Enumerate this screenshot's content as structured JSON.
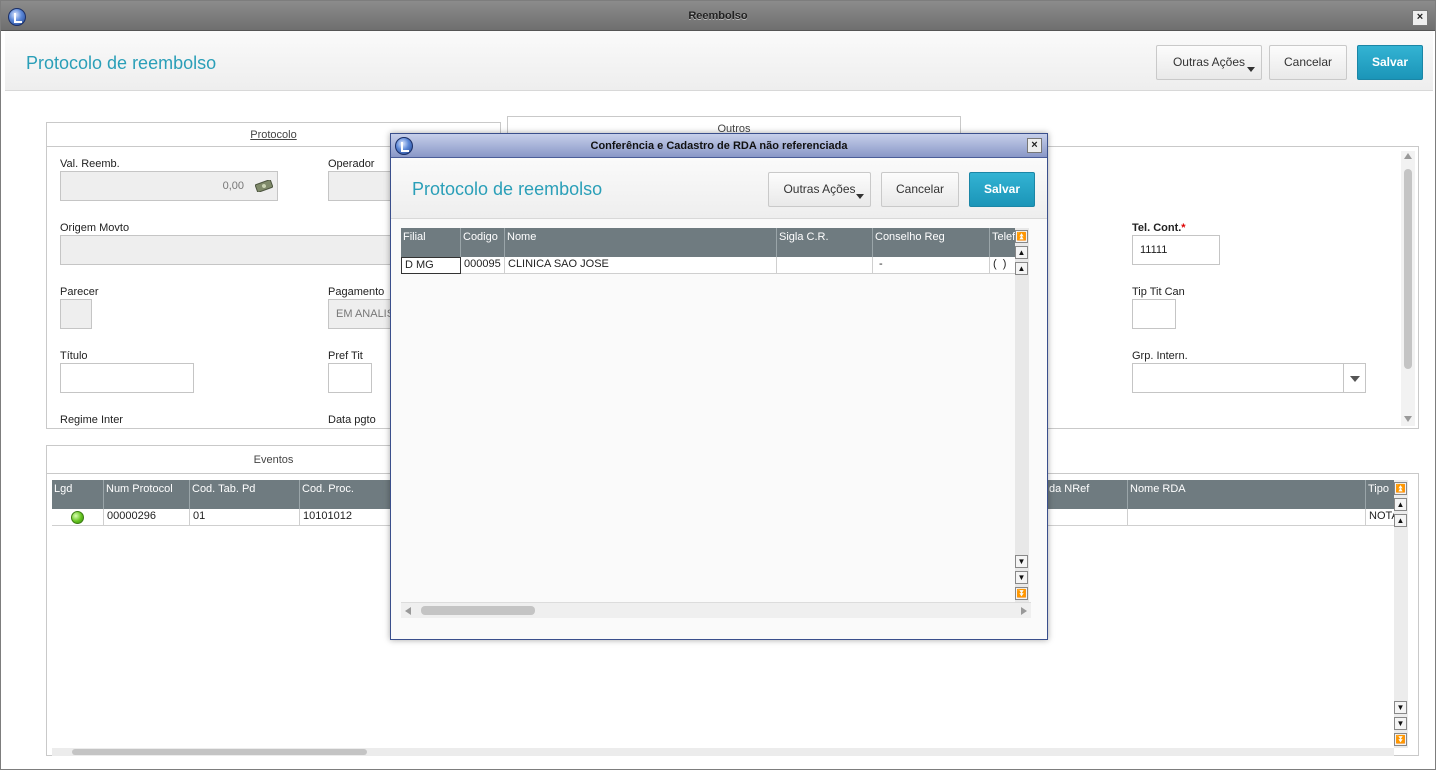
{
  "window": {
    "title": "Reembolso",
    "close": "×"
  },
  "header": {
    "title": "Protocolo de reembolso",
    "outras_acoes": "Outras Ações",
    "cancelar": "Cancelar",
    "salvar": "Salvar"
  },
  "tabs": {
    "protocolo": "Protocolo",
    "outros": "Outros",
    "eventos": "Eventos"
  },
  "form": {
    "val_reemb": {
      "label": "Val. Reemb.",
      "value": "0,00"
    },
    "operador": {
      "label": "Operador",
      "value": ""
    },
    "origem_movto": {
      "label": "Origem Movto",
      "value": ""
    },
    "parecer": {
      "label": "Parecer",
      "value": ""
    },
    "pagamento": {
      "label": "Pagamento",
      "value": "EM ANALISE"
    },
    "titulo": {
      "label": "Título",
      "value": ""
    },
    "pref_tit": {
      "label": "Pref Tit",
      "value": ""
    },
    "regime_inter": {
      "label": "Regime Inter"
    },
    "data_pgto": {
      "label": "Data pgto"
    },
    "tel_cont": {
      "label": "Tel. Cont.",
      "value": "11111"
    },
    "tip_tit_can": {
      "label": "Tip Tit Can",
      "value": ""
    },
    "grp_intern": {
      "label": "Grp. Intern.",
      "value": ""
    }
  },
  "eventos_grid": {
    "columns": [
      "Lgd",
      "Num Protocol",
      "Cod. Tab. Pd",
      "Cod. Proc.",
      "da NRef",
      "Nome RDA",
      "Tipo"
    ],
    "rows": [
      {
        "num_protocol": "00000296",
        "cod_tab_pd": "01",
        "cod_proc": "10101012",
        "da_nref": "",
        "nome_rda": "",
        "tipo": "NOTA"
      }
    ]
  },
  "modal": {
    "title": "Conferência e Cadastro de RDA não referenciada",
    "header_title": "Protocolo de reembolso",
    "outras_acoes": "Outras Ações",
    "cancelar": "Cancelar",
    "salvar": "Salvar",
    "grid": {
      "columns": [
        "Filial",
        "Codigo",
        "Nome",
        "Sigla C.R.",
        "Conselho Reg",
        "Telef"
      ],
      "rows": [
        {
          "filial": "D MG",
          "codigo": "000095",
          "nome": "CLINICA SAO JOSE",
          "sigla": "",
          "conselho": " -",
          "telefone": "(  )"
        }
      ]
    }
  },
  "nav": {
    "first": "⏫",
    "prev_page": "▲",
    "prev": "▲",
    "next": "▼",
    "next_page": "▼",
    "last": "⏬"
  },
  "colors": {
    "accent": "#2a9fb8",
    "primary_button": "#1b95b8",
    "grid_header": "#6f7b80",
    "status_ok": "#63c21e"
  },
  "icons": {
    "app": "app-logo-icon",
    "money": "money-icon",
    "dropdown": "chevron-down-icon",
    "legend": "status-dot-icon"
  }
}
